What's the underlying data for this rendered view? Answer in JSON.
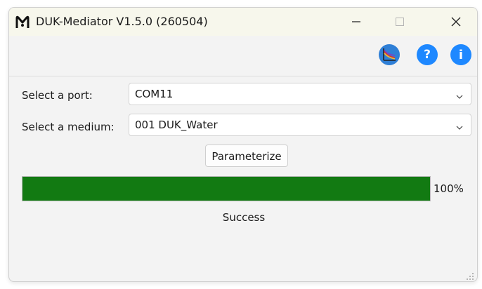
{
  "window": {
    "title": "DUK-Mediator V1.5.0 (260504)"
  },
  "toolbar": {
    "icons": [
      "chart-icon",
      "help-icon",
      "info-icon"
    ],
    "help_glyph": "?",
    "info_glyph": "i"
  },
  "form": {
    "port_label": "Select a port:",
    "port_value": "COM11",
    "medium_label": "Select a medium:",
    "medium_value": "001 DUK_Water",
    "parameterize_label": "Parameterize"
  },
  "progress": {
    "value": 1.0,
    "percent_text": "100%",
    "status": "Success"
  },
  "colors": {
    "progress_fill": "#127a12",
    "accent": "#1e88ff"
  }
}
